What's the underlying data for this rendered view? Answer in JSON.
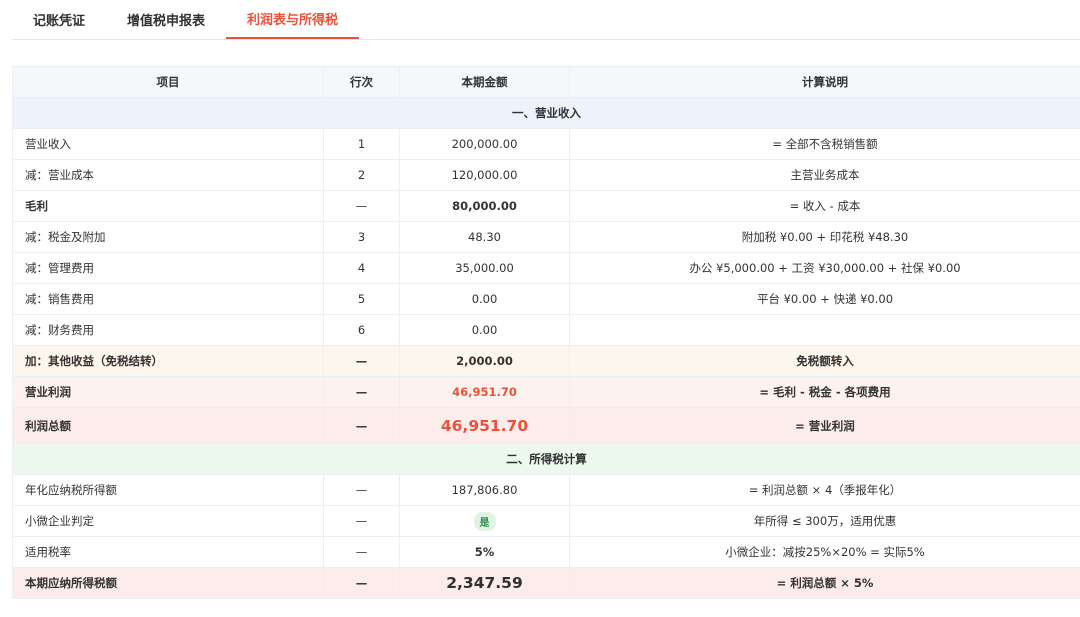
{
  "tabs": [
    {
      "label": "记账凭证",
      "active": false
    },
    {
      "label": "增值税申报表",
      "active": false
    },
    {
      "label": "利润表与所得税",
      "active": true
    }
  ],
  "table": {
    "headers": {
      "item": "项目",
      "line": "行次",
      "amount": "本期金额",
      "note": "计算说明"
    },
    "sections": {
      "revenue": "一、营业收入",
      "income_tax": "二、所得税计算"
    },
    "rows": [
      {
        "item": "营业收入",
        "line": "1",
        "amount": "200,000.00",
        "note": "= 全部不含税销售额"
      },
      {
        "item": "减：营业成本",
        "line": "2",
        "amount": "120,000.00",
        "note": "主营业务成本"
      },
      {
        "item": "毛利",
        "line": "—",
        "amount": "80,000.00",
        "note": "= 收入 - 成本"
      },
      {
        "item": "减：税金及附加",
        "line": "3",
        "amount": "48.30",
        "note": "附加税 ¥0.00 + 印花税 ¥48.30"
      },
      {
        "item": "减：管理费用",
        "line": "4",
        "amount": "35,000.00",
        "note": "办公 ¥5,000.00 + 工资 ¥30,000.00 + 社保 ¥0.00"
      },
      {
        "item": "减：销售费用",
        "line": "5",
        "amount": "0.00",
        "note": "平台 ¥0.00 + 快递 ¥0.00"
      },
      {
        "item": "减：财务费用",
        "line": "6",
        "amount": "0.00",
        "note": ""
      },
      {
        "item": "加：其他收益（免税结转）",
        "line": "—",
        "amount": "2,000.00",
        "note": "免税额转入"
      },
      {
        "item": "营业利润",
        "line": "—",
        "amount": "46,951.70",
        "note": "= 毛利 - 税金 - 各项费用"
      },
      {
        "item": "利润总额",
        "line": "—",
        "amount": "46,951.70",
        "note": "= 营业利润"
      },
      {
        "item": "年化应纳税所得额",
        "line": "—",
        "amount": "187,806.80",
        "note": "= 利润总额 × 4（季报年化）"
      },
      {
        "item": "小微企业判定",
        "line": "—",
        "amount": "是",
        "note": "年所得 ≤ 300万，适用优惠"
      },
      {
        "item": "适用税率",
        "line": "—",
        "amount": "5%",
        "note": "小微企业：减按25%×20% = 实际5%"
      },
      {
        "item": "本期应纳所得税额",
        "line": "—",
        "amount": "2,347.59",
        "note": "= 利润总额 × 5%"
      }
    ]
  },
  "colors": {
    "accent": "#e8543b",
    "badge_bg": "#e1f3e5",
    "badge_text": "#2f8f4a"
  }
}
